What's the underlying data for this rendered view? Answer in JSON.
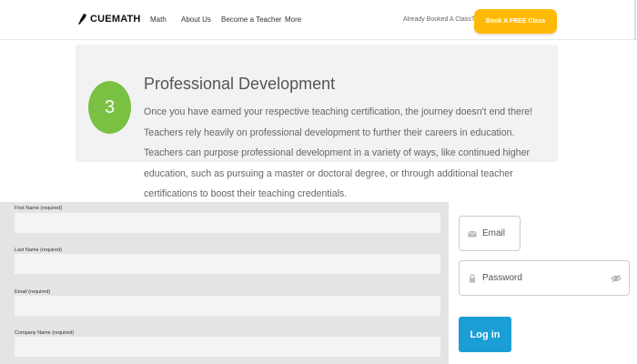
{
  "nav": {
    "brand": "CUEMATH",
    "links": [
      "Math",
      "About Us",
      "Become a Teacher",
      "More"
    ],
    "already_booked": "Already Booked A Class?",
    "cta_label": "Book A FREE Class"
  },
  "card": {
    "step_number": "3",
    "title": "Professional Development",
    "body": "Once you have earned your respective teaching certification, the journey doesn't end there! Teachers rely heavily on professional development to further their careers in education. Teachers can purpose professional development in a variety of ways, like continued higher education, such as pursuing a master or doctoral degree, or through additional teacher certifications to boost their teaching credentials."
  },
  "form": {
    "fields": [
      {
        "label": "First Name (required)",
        "value": ""
      },
      {
        "label": "Last Name (required)",
        "value": ""
      },
      {
        "label": "Email (required)",
        "value": ""
      },
      {
        "label": "Company Name (required)",
        "value": ""
      }
    ]
  },
  "login": {
    "email_placeholder": "Email",
    "password_placeholder": "Password",
    "login_label": "Log in"
  },
  "colors": {
    "cta": "#ffba07",
    "badge": "#7ac143",
    "login_button": "#1b9ed6"
  }
}
